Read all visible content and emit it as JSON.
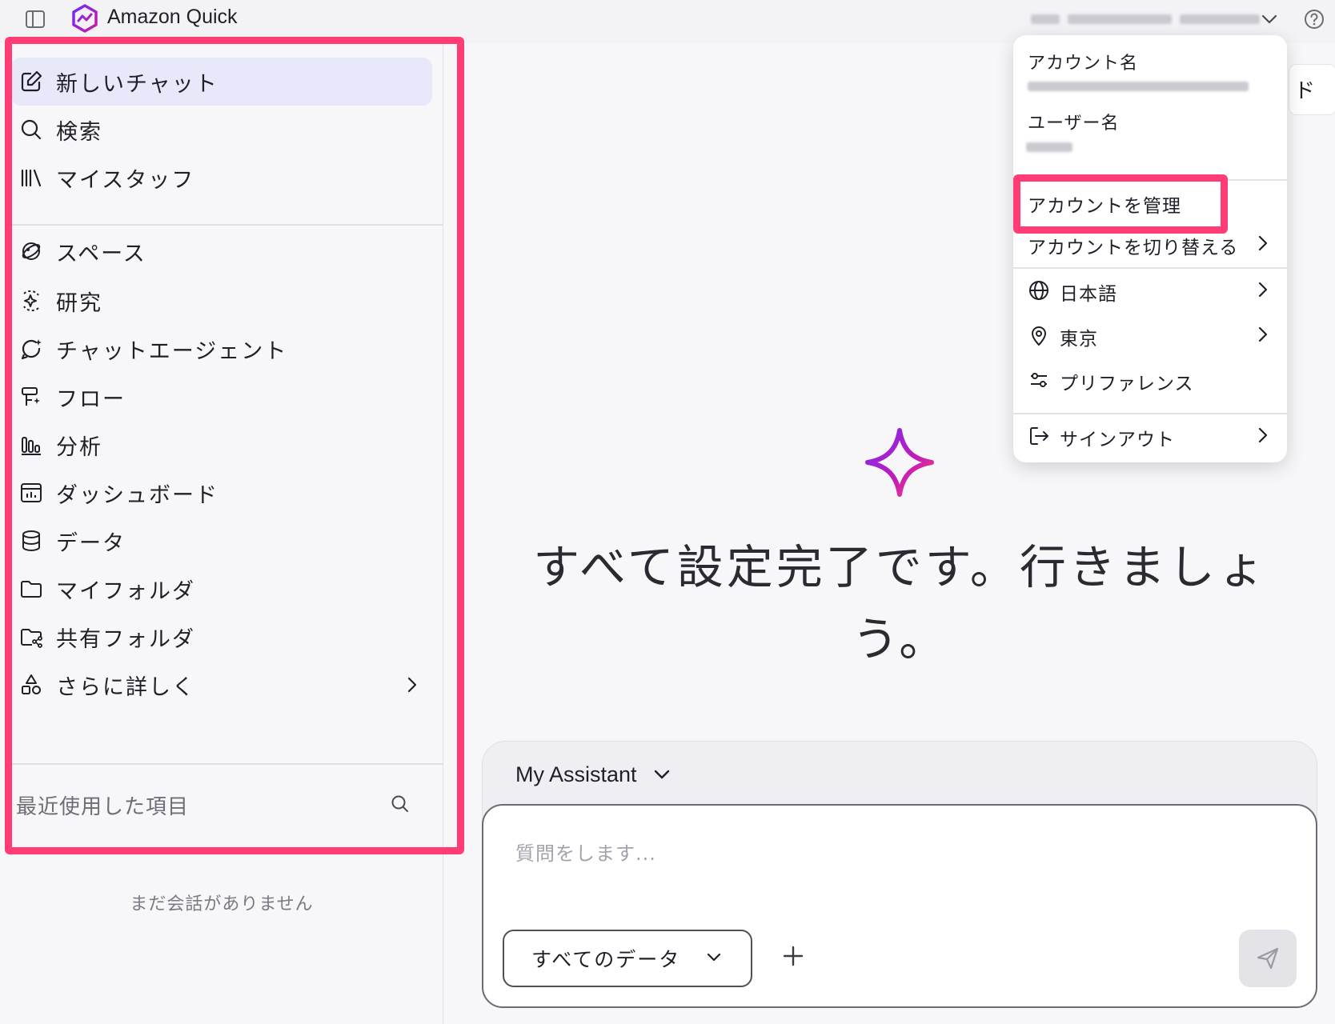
{
  "app": {
    "title": "Amazon Quick"
  },
  "sidebar": {
    "items": [
      {
        "label": "新しいチャット",
        "icon": "edit-icon"
      },
      {
        "label": "検索",
        "icon": "search-icon"
      },
      {
        "label": "マイスタッフ",
        "icon": "library-icon"
      },
      {
        "label": "スペース",
        "icon": "spaces-icon"
      },
      {
        "label": "研究",
        "icon": "research-icon"
      },
      {
        "label": "チャットエージェント",
        "icon": "chat-agent-icon"
      },
      {
        "label": "フロー",
        "icon": "flow-icon"
      },
      {
        "label": "分析",
        "icon": "analysis-icon"
      },
      {
        "label": "ダッシュボード",
        "icon": "dashboard-icon"
      },
      {
        "label": "データ",
        "icon": "database-icon"
      },
      {
        "label": "マイフォルダ",
        "icon": "folder-icon"
      },
      {
        "label": "共有フォルダ",
        "icon": "shared-folder-icon"
      },
      {
        "label": "さらに詳しく",
        "icon": "shapes-icon"
      }
    ],
    "recent_label": "最近使用した項目",
    "empty_text": "まだ会話がありません"
  },
  "main": {
    "peek_text": "ド",
    "hero": "すべて設定完了です。行きましょう。",
    "assistant": "My Assistant",
    "input_placeholder": "質問をします...",
    "data_scope": "すべてのデータ"
  },
  "account_menu": {
    "account_name_label": "アカウント名",
    "username_label": "ユーザー名",
    "items": [
      {
        "label": "アカウントを管理"
      },
      {
        "label": "アカウントを切り替える"
      },
      {
        "label": "日本語",
        "icon": "globe-icon"
      },
      {
        "label": "東京",
        "icon": "location-pin-icon"
      },
      {
        "label": "プリファレンス",
        "icon": "sliders-icon"
      },
      {
        "label": "サインアウト",
        "icon": "sign-out-icon"
      }
    ]
  },
  "colors": {
    "highlight": "#ff3d74",
    "active_nav": "#e8e8fb",
    "brand": "#a020c8"
  }
}
